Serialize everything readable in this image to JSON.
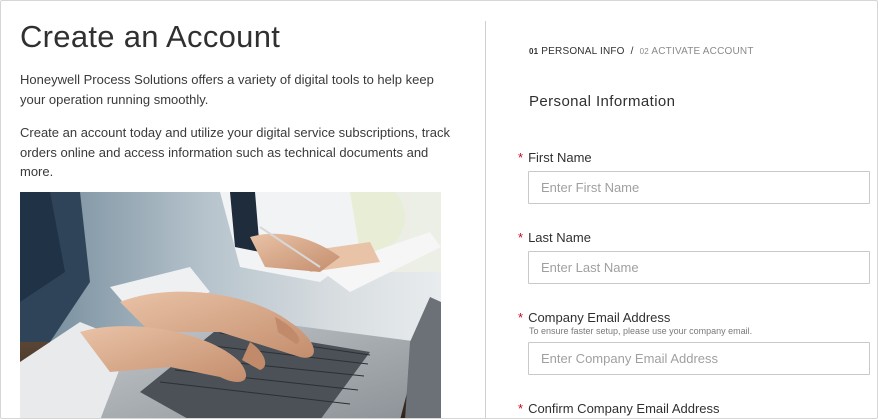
{
  "left": {
    "title": "Create an Account",
    "intro": "Honeywell Process Solutions offers a variety of digital tools to help keep your operation running smoothly.",
    "description": "Create an account today and utilize your digital service subscriptions, track orders online and access information such as technical documents and more."
  },
  "steps": {
    "step1_num": "01",
    "step1_label": "PERSONAL INFO",
    "separator": "/",
    "step2_num": "02",
    "step2_label": "ACTIVATE ACCOUNT"
  },
  "form": {
    "section_title": "Personal Information",
    "required_mark": "*",
    "first_name": {
      "label": "First Name",
      "placeholder": "Enter First Name",
      "value": ""
    },
    "last_name": {
      "label": "Last Name",
      "placeholder": "Enter Last Name",
      "value": ""
    },
    "company_email": {
      "label": "Company Email Address",
      "hint": "To ensure faster setup, please use your company email.",
      "placeholder": "Enter Company Email Address",
      "value": ""
    },
    "confirm_email": {
      "label": "Confirm Company Email Address"
    }
  },
  "colors": {
    "required": "#d0021b",
    "text": "#303030",
    "border": "#c9c9c9"
  }
}
